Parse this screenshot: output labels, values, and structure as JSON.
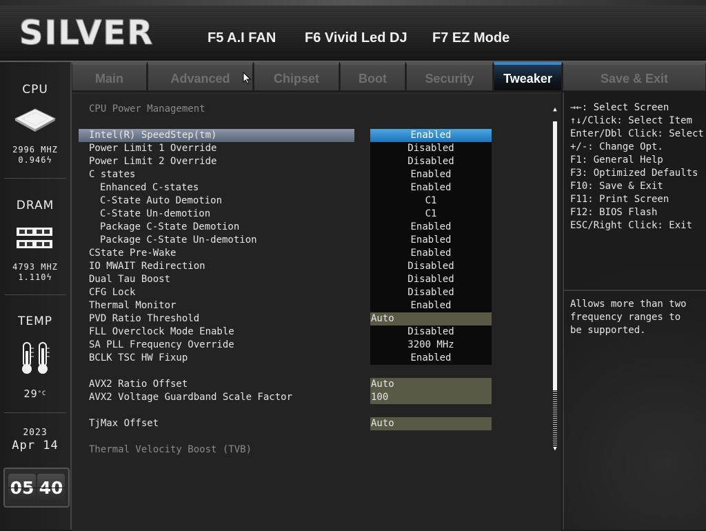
{
  "header": {
    "logo": "SILVER",
    "hotkeys": [
      "F5 A.I FAN",
      "F6 Vivid Led DJ",
      "F7 EZ Mode"
    ]
  },
  "sidebar": {
    "cpu": {
      "label": "CPU",
      "freq": "2996 MHZ",
      "volt": "0.946"
    },
    "dram": {
      "label": "DRAM",
      "freq": "4793 MHZ",
      "volt": "1.110"
    },
    "temp": {
      "label": "TEMP",
      "value": "29",
      "unit": "°C"
    },
    "date": {
      "year": "2023",
      "month_day": "Apr 14"
    },
    "clock": {
      "hour": "05",
      "minute": "40"
    }
  },
  "tabs": [
    {
      "label": "Main"
    },
    {
      "label": "Advanced"
    },
    {
      "label": "Chipset"
    },
    {
      "label": "Boot"
    },
    {
      "label": "Security"
    },
    {
      "label": "Tweaker",
      "active": true
    },
    {
      "label": "Save & Exit"
    }
  ],
  "main": {
    "section_title": "CPU Power Management",
    "settings": [
      {
        "label": "Intel(R) SpeedStep(tm)",
        "value": "Enabled",
        "selected": true
      },
      {
        "label": "Power Limit 1 Override",
        "value": "Disabled"
      },
      {
        "label": "Power Limit 2 Override",
        "value": "Disabled"
      },
      {
        "label": "C states",
        "value": "Enabled"
      },
      {
        "label": "Enhanced C-states",
        "value": "Enabled",
        "indent": true
      },
      {
        "label": "C-State Auto Demotion",
        "value": "C1",
        "indent": true
      },
      {
        "label": "C-State Un-demotion",
        "value": "C1",
        "indent": true
      },
      {
        "label": "Package C-State Demotion",
        "value": "Enabled",
        "indent": true
      },
      {
        "label": "Package C-State Un-demotion",
        "value": "Enabled",
        "indent": true
      },
      {
        "label": "CState Pre-Wake",
        "value": "Enabled"
      },
      {
        "label": "IO MWAIT Redirection",
        "value": "Disabled"
      },
      {
        "label": "Dual Tau Boost",
        "value": "Disabled"
      },
      {
        "label": "CFG Lock",
        "value": "Disabled"
      },
      {
        "label": "Thermal Monitor",
        "value": "Enabled"
      },
      {
        "label": "PVD Ratio Threshold",
        "value": "Auto",
        "input": true
      },
      {
        "label": "FLL Overclock Mode Enable",
        "value": "Disabled"
      },
      {
        "label": "SA PLL Frequency Override",
        "value": "3200 MHz"
      },
      {
        "label": "BCLK TSC HW Fixup",
        "value": "Enabled"
      }
    ],
    "avx": [
      {
        "label": "AVX2 Ratio Offset",
        "value": "Auto",
        "input": true
      },
      {
        "label": "AVX2 Voltage Guardband Scale Factor",
        "value": "100",
        "input": true
      }
    ],
    "tjmax": {
      "label": "TjMax Offset",
      "value": "Auto",
      "input": true
    },
    "footer_section": "Thermal Velocity Boost (TVB)"
  },
  "help": {
    "keys": [
      "→←: Select Screen",
      "↑↓/Click: Select Item",
      "Enter/Dbl Click: Select",
      "+/-: Change Opt.",
      "F1: General Help",
      "F3: Optimized Defaults",
      "F10: Save & Exit",
      "F11: Print Screen",
      "F12: BIOS Flash",
      "ESC/Right Click: Exit"
    ],
    "description": [
      "Allows more than two",
      "frequency ranges to",
      "be supported."
    ]
  },
  "colors": {
    "accent_tab": "#3f86c7",
    "selected_value": "#2a8fd4",
    "input_value": "#595a45"
  }
}
